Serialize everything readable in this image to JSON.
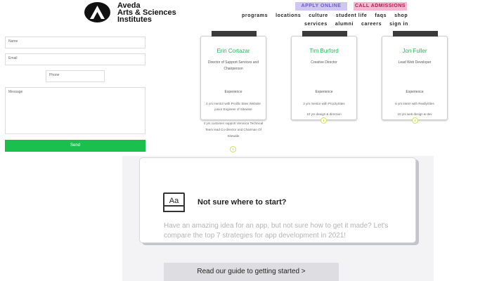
{
  "header": {
    "logo_icon": "aveda-logo-icon",
    "logo_lines": [
      "Aveda",
      "Arts & Sciences",
      "Institutes"
    ],
    "apply_label": "APPLY ONLINE",
    "call_label": "CALL ADMISSIONS",
    "nav_row1": [
      "programs",
      "locations",
      "culture",
      "student life",
      "faqs",
      "shop"
    ],
    "nav_row2": [
      "services",
      "alumni",
      "careers",
      "sign in"
    ],
    "colors": {
      "apply_bg": "#cfc6f4",
      "call_bg": "#f6b7d0"
    }
  },
  "form": {
    "name_placeholder": "Name",
    "email_placeholder": "Email",
    "phone_placeholder": "Phone",
    "message_placeholder": "Message",
    "send_label": "Send",
    "send_color": "#1bbf4e"
  },
  "team": [
    {
      "name": "Erin Cortazar",
      "role": "Director of Support Services and Chairperson",
      "experience_heading": "Experience",
      "exp1": "4 yrs mentor with Prolific Sites Website junior Engineer of Sitewise",
      "exp2": "4 yrs customer support Veronica Technical Team lead Co-director and Chairman Of Sitewide"
    },
    {
      "name": "Tim Burford",
      "role": "Creative Director",
      "experience_heading": "Experience",
      "exp1": "2 yrs mentor with ProcitySites",
      "exp2": "10 yrs design & direction"
    },
    {
      "name": "Jon Fuller",
      "role": "Lead Web Developer",
      "experience_heading": "Experience",
      "exp1": "6 yrs Intern with ReallySites",
      "exp2": "10 yrs web design & dev"
    }
  ],
  "guide": {
    "icon": "book-icon",
    "icon_text": "Aa",
    "title": "Not sure where to start?",
    "description": "Have an amazing idea for an app, but not sure how to get it made? Let's compare the top 7 strategies for app development in 2021!",
    "button_label": "Read our guide to getting started >"
  }
}
